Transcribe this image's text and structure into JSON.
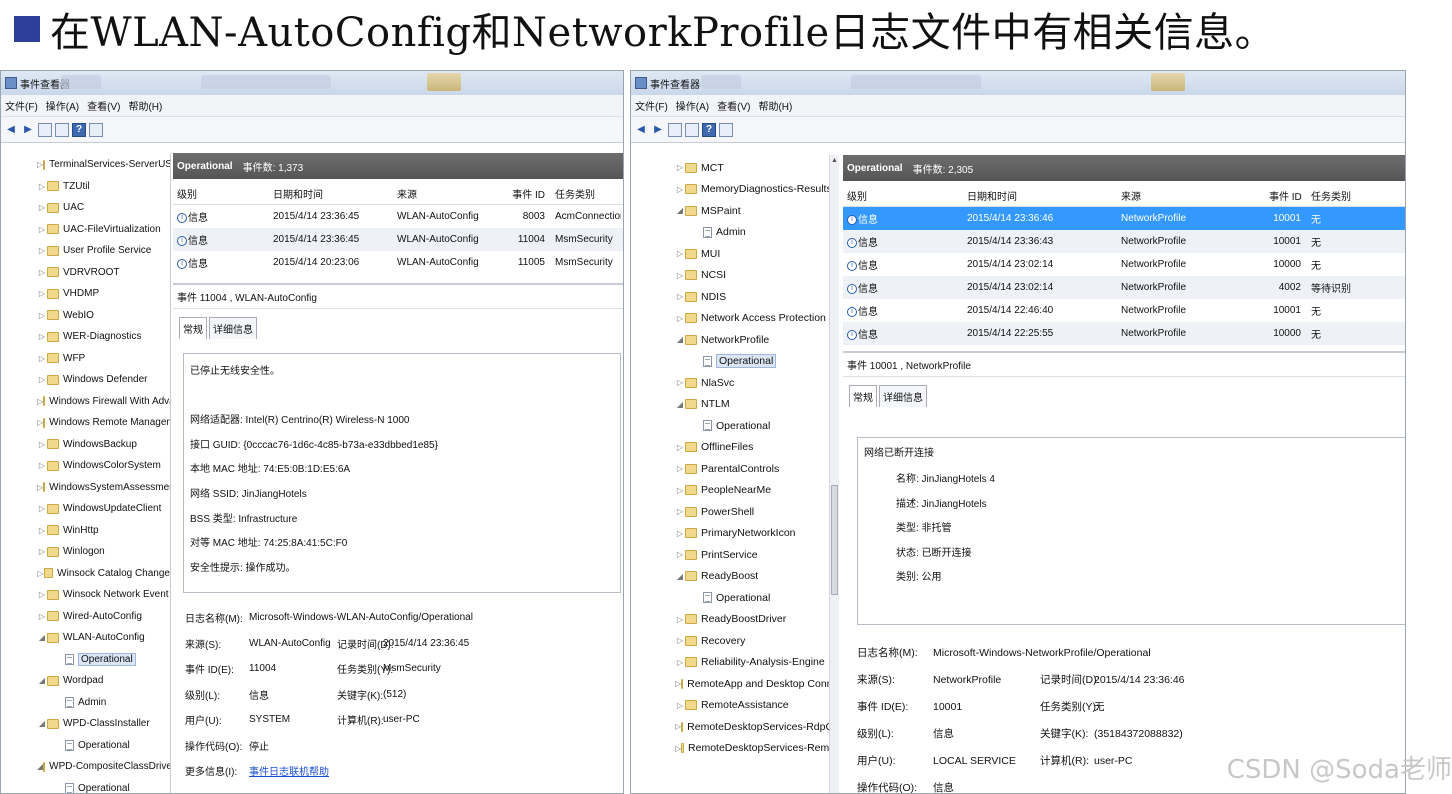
{
  "slide": {
    "title": "在WLAN-AutoConfig和NetworkProfile日志文件中有相关信息。",
    "bullet_color": "#2e3f9a"
  },
  "watermark": "CSDN @Soda老师",
  "left": {
    "app_title": "事件查看器",
    "menu": [
      "文件(F)",
      "操作(A)",
      "查看(V)",
      "帮助(H)"
    ],
    "tree": [
      {
        "label": "TerminalServices-ServerUSBDe",
        "type": "folder",
        "caret": "▷"
      },
      {
        "label": "TZUtil",
        "type": "folder",
        "caret": "▷"
      },
      {
        "label": "UAC",
        "type": "folder",
        "caret": "▷"
      },
      {
        "label": "UAC-FileVirtualization",
        "type": "folder",
        "caret": "▷"
      },
      {
        "label": "User Profile Service",
        "type": "folder",
        "caret": "▷"
      },
      {
        "label": "VDRVROOT",
        "type": "folder",
        "caret": "▷"
      },
      {
        "label": "VHDMP",
        "type": "folder",
        "caret": "▷"
      },
      {
        "label": "WebIO",
        "type": "folder",
        "caret": "▷"
      },
      {
        "label": "WER-Diagnostics",
        "type": "folder",
        "caret": "▷"
      },
      {
        "label": "WFP",
        "type": "folder",
        "caret": "▷"
      },
      {
        "label": "Windows Defender",
        "type": "folder",
        "caret": "▷"
      },
      {
        "label": "Windows Firewall With Advance",
        "type": "folder",
        "caret": "▷"
      },
      {
        "label": "Windows Remote Management",
        "type": "folder",
        "caret": "▷"
      },
      {
        "label": "WindowsBackup",
        "type": "folder",
        "caret": "▷"
      },
      {
        "label": "WindowsColorSystem",
        "type": "folder",
        "caret": "▷"
      },
      {
        "label": "WindowsSystemAssessmentToo",
        "type": "folder",
        "caret": "▷"
      },
      {
        "label": "WindowsUpdateClient",
        "type": "folder",
        "caret": "▷"
      },
      {
        "label": "WinHttp",
        "type": "folder",
        "caret": "▷"
      },
      {
        "label": "Winlogon",
        "type": "folder",
        "caret": "▷"
      },
      {
        "label": "Winsock Catalog Change",
        "type": "folder",
        "caret": "▷"
      },
      {
        "label": "Winsock Network Event",
        "type": "folder",
        "caret": "▷"
      },
      {
        "label": "Wired-AutoConfig",
        "type": "folder",
        "caret": "▷"
      },
      {
        "label": "WLAN-AutoConfig",
        "type": "folder",
        "caret": "◢"
      },
      {
        "label": "Operational",
        "type": "log",
        "caret": "",
        "selected": true
      },
      {
        "label": "Wordpad",
        "type": "folder",
        "caret": "◢"
      },
      {
        "label": "Admin",
        "type": "log",
        "caret": ""
      },
      {
        "label": "WPD-ClassInstaller",
        "type": "folder",
        "caret": "◢"
      },
      {
        "label": "Operational",
        "type": "log",
        "caret": ""
      },
      {
        "label": "WPD-CompositeClassDriver",
        "type": "folder",
        "caret": "◢"
      },
      {
        "label": "Operational",
        "type": "log",
        "caret": ""
      }
    ],
    "pane_name": "Operational",
    "event_count": "事件数: 1,373",
    "columns": [
      "级别",
      "日期和时间",
      "来源",
      "事件 ID",
      "任务类别"
    ],
    "rows": [
      {
        "level": "信息",
        "datetime": "2015/4/14 23:36:45",
        "source": "WLAN-AutoConfig",
        "id": "8003",
        "category": "AcmConnection"
      },
      {
        "level": "信息",
        "datetime": "2015/4/14 23:36:45",
        "source": "WLAN-AutoConfig",
        "id": "11004",
        "category": "MsmSecurity"
      },
      {
        "level": "信息",
        "datetime": "2015/4/14 20:23:06",
        "source": "WLAN-AutoConfig",
        "id": "11005",
        "category": "MsmSecurity"
      }
    ],
    "detail_title": "事件 11004 , WLAN-AutoConfig",
    "tabs": [
      "常规",
      "详细信息"
    ],
    "message": [
      "已停止无线安全性。",
      "",
      "网络适配器: Intel(R) Centrino(R) Wireless-N 1000",
      "接口 GUID: {0cccac76-1d6c-4c85-b73a-e33dbbed1e85}",
      "本地 MAC 地址: 74:E5:0B:1D:E5:6A",
      "网络 SSID: JinJiangHotels",
      "BSS 类型: Infrastructure",
      "对等 MAC 地址: 74:25:8A:41:5C:F0",
      "安全性提示: 操作成功。"
    ],
    "props": {
      "log_name_label": "日志名称(M):",
      "log_name": "Microsoft-Windows-WLAN-AutoConfig/Operational",
      "source_label": "来源(S):",
      "source": "WLAN-AutoConfig",
      "logged_label": "记录时间(D):",
      "logged": "2015/4/14 23:36:45",
      "eventid_label": "事件 ID(E):",
      "eventid": "11004",
      "task_label": "任务类别(Y):",
      "task": "MsmSecurity",
      "level_label": "级别(L):",
      "level": "信息",
      "keywords_label": "关键字(K):",
      "keywords": "(512)",
      "user_label": "用户(U):",
      "user": "SYSTEM",
      "computer_label": "计算机(R):",
      "computer": "user-PC",
      "opcode_label": "操作代码(O):",
      "opcode": "停止",
      "more_label": "更多信息(I):",
      "more": "事件日志联机帮助"
    }
  },
  "right": {
    "app_title": "事件查看器",
    "menu": [
      "文件(F)",
      "操作(A)",
      "查看(V)",
      "帮助(H)"
    ],
    "tree": [
      {
        "label": "MCT",
        "type": "folder",
        "caret": "▷"
      },
      {
        "label": "MemoryDiagnostics-Results",
        "type": "folder",
        "caret": "▷"
      },
      {
        "label": "MSPaint",
        "type": "folder",
        "caret": "◢"
      },
      {
        "label": "Admin",
        "type": "log",
        "caret": ""
      },
      {
        "label": "MUI",
        "type": "folder",
        "caret": "▷"
      },
      {
        "label": "NCSI",
        "type": "folder",
        "caret": "▷"
      },
      {
        "label": "NDIS",
        "type": "folder",
        "caret": "▷"
      },
      {
        "label": "Network Access Protection",
        "type": "folder",
        "caret": "▷"
      },
      {
        "label": "NetworkProfile",
        "type": "folder",
        "caret": "◢"
      },
      {
        "label": "Operational",
        "type": "log",
        "caret": "",
        "selected": true
      },
      {
        "label": "NlaSvc",
        "type": "folder",
        "caret": "▷"
      },
      {
        "label": "NTLM",
        "type": "folder",
        "caret": "◢"
      },
      {
        "label": "Operational",
        "type": "log",
        "caret": ""
      },
      {
        "label": "OfflineFiles",
        "type": "folder",
        "caret": "▷"
      },
      {
        "label": "ParentalControls",
        "type": "folder",
        "caret": "▷"
      },
      {
        "label": "PeopleNearMe",
        "type": "folder",
        "caret": "▷"
      },
      {
        "label": "PowerShell",
        "type": "folder",
        "caret": "▷"
      },
      {
        "label": "PrimaryNetworkIcon",
        "type": "folder",
        "caret": "▷"
      },
      {
        "label": "PrintService",
        "type": "folder",
        "caret": "▷"
      },
      {
        "label": "ReadyBoost",
        "type": "folder",
        "caret": "◢"
      },
      {
        "label": "Operational",
        "type": "log",
        "caret": ""
      },
      {
        "label": "ReadyBoostDriver",
        "type": "folder",
        "caret": "▷"
      },
      {
        "label": "Recovery",
        "type": "folder",
        "caret": "▷"
      },
      {
        "label": "Reliability-Analysis-Engine",
        "type": "folder",
        "caret": "▷"
      },
      {
        "label": "RemoteApp and Desktop Conne",
        "type": "folder",
        "caret": "▷"
      },
      {
        "label": "RemoteAssistance",
        "type": "folder",
        "caret": "▷"
      },
      {
        "label": "RemoteDesktopServices-RdpCo",
        "type": "folder",
        "caret": "▷"
      },
      {
        "label": "RemoteDesktopServices-Remot",
        "type": "folder",
        "caret": "▷"
      }
    ],
    "pane_name": "Operational",
    "event_count": "事件数: 2,305",
    "columns": [
      "级别",
      "日期和时间",
      "来源",
      "事件 ID",
      "任务类别"
    ],
    "rows": [
      {
        "level": "信息",
        "datetime": "2015/4/14 23:36:46",
        "source": "NetworkProfile",
        "id": "10001",
        "category": "无",
        "selected": true
      },
      {
        "level": "信息",
        "datetime": "2015/4/14 23:36:43",
        "source": "NetworkProfile",
        "id": "10001",
        "category": "无"
      },
      {
        "level": "信息",
        "datetime": "2015/4/14 23:02:14",
        "source": "NetworkProfile",
        "id": "10000",
        "category": "无"
      },
      {
        "level": "信息",
        "datetime": "2015/4/14 23:02:14",
        "source": "NetworkProfile",
        "id": "4002",
        "category": "等待识别"
      },
      {
        "level": "信息",
        "datetime": "2015/4/14 22:46:40",
        "source": "NetworkProfile",
        "id": "10001",
        "category": "无"
      },
      {
        "level": "信息",
        "datetime": "2015/4/14 22:25:55",
        "source": "NetworkProfile",
        "id": "10000",
        "category": "无"
      }
    ],
    "detail_title": "事件 10001 , NetworkProfile",
    "tabs": [
      "常规",
      "详细信息"
    ],
    "message_head": "网络已断开连接",
    "message": [
      "名称: JinJiangHotels  4",
      "描述: JinJiangHotels",
      "类型: 非托管",
      "状态: 已断开连接",
      "类别: 公用"
    ],
    "props": {
      "log_name_label": "日志名称(M):",
      "log_name": "Microsoft-Windows-NetworkProfile/Operational",
      "source_label": "来源(S):",
      "source": "NetworkProfile",
      "logged_label": "记录时间(D):",
      "logged": "2015/4/14 23:36:46",
      "eventid_label": "事件 ID(E):",
      "eventid": "10001",
      "task_label": "任务类别(Y):",
      "task": "无",
      "level_label": "级别(L):",
      "level": "信息",
      "keywords_label": "关键字(K):",
      "keywords": "(35184372088832)",
      "user_label": "用户(U):",
      "user": "LOCAL SERVICE",
      "computer_label": "计算机(R):",
      "computer": "user-PC",
      "opcode_label": "操作代码(O):",
      "opcode": "信息"
    }
  }
}
